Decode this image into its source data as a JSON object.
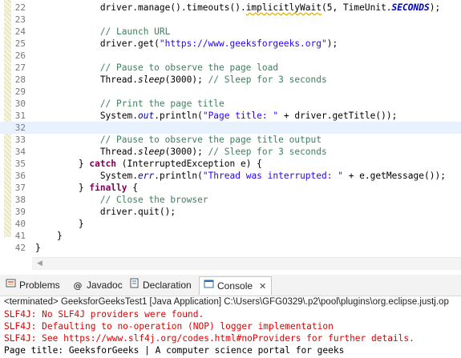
{
  "editor": {
    "lines": [
      {
        "n": "22"
      },
      {
        "n": "23"
      },
      {
        "n": "24"
      },
      {
        "n": "25"
      },
      {
        "n": "26"
      },
      {
        "n": "27"
      },
      {
        "n": "28"
      },
      {
        "n": "29"
      },
      {
        "n": "30"
      },
      {
        "n": "31"
      },
      {
        "n": "32"
      },
      {
        "n": "33"
      },
      {
        "n": "34"
      },
      {
        "n": "35"
      },
      {
        "n": "36"
      },
      {
        "n": "37"
      },
      {
        "n": "38"
      },
      {
        "n": "39"
      },
      {
        "n": "40"
      },
      {
        "n": "41"
      },
      {
        "n": "42"
      }
    ],
    "code": {
      "l22a": "            driver.manage().timeouts().",
      "l22b": "implicitlyWait",
      "l22c": "(5, TimeUnit.",
      "l22d": "SECONDS",
      "l22e": ");",
      "l24": "            // Launch URL",
      "l25a": "            driver.get(",
      "l25b": "\"https://www.geeksforgeeks.org\"",
      "l25c": ");",
      "l27": "            // Pause to observe the page load",
      "l28a": "            Thread.",
      "l28b": "sleep",
      "l28c": "(3000); ",
      "l28d": "// Sleep for 3 seconds",
      "l30": "            // Print the page title",
      "l31a": "            System.",
      "l31b": "out",
      "l31c": ".println(",
      "l31d": "\"Page title: \"",
      "l31e": " + driver.getTitle());",
      "l33": "            // Pause to observe the page title output",
      "l34a": "            Thread.",
      "l34b": "sleep",
      "l34c": "(3000); ",
      "l34d": "// Sleep for 3 seconds",
      "l35a": "        } ",
      "l35b": "catch",
      "l35c": " (InterruptedException e) {",
      "l36a": "            System.",
      "l36b": "err",
      "l36c": ".println(",
      "l36d": "\"Thread was interrupted: \"",
      "l36e": " + e.getMessage());",
      "l37a": "        } ",
      "l37b": "finally",
      "l37c": " {",
      "l38": "            // Close the browser",
      "l39": "            driver.quit();",
      "l40": "        }",
      "l41": "    }",
      "l42": "}"
    }
  },
  "tabs": [
    {
      "label": "Problems",
      "icon": "problems-icon"
    },
    {
      "label": "Javadoc",
      "icon": "javadoc-icon"
    },
    {
      "label": "Declaration",
      "icon": "declaration-icon"
    },
    {
      "label": "Console",
      "icon": "console-icon",
      "close": "✕"
    }
  ],
  "console": {
    "terminated": "<terminated> GeeksforGeeksTest1 [Java Application] C:\\Users\\GFG0329\\.p2\\pool\\plugins\\org.eclipse.justj.op",
    "lines": [
      "SLF4J: No SLF4J providers were found.",
      "SLF4J: Defaulting to no-operation (NOP) logger implementation",
      "SLF4J: See https://www.slf4j.org/codes.html#noProviders for further details.",
      "Page title: GeeksforGeeks | A computer science portal for geeks"
    ]
  },
  "colors": {
    "keyword": "#7f0055",
    "string": "#2a00ff",
    "comment": "#3f7f5f",
    "field": "#0000c0",
    "error": "#e00000"
  }
}
